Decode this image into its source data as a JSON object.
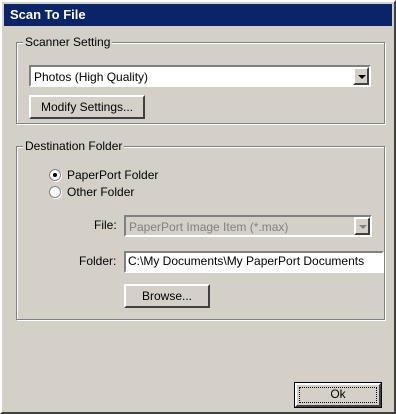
{
  "window": {
    "title": "Scan To File"
  },
  "scanner_setting": {
    "legend": "Scanner Setting",
    "selected": "Photos (High Quality)",
    "modify_button": "Modify Settings..."
  },
  "destination": {
    "legend": "Destination Folder",
    "radios": [
      {
        "label": "PaperPort Folder",
        "checked": true
      },
      {
        "label": "Other Folder",
        "checked": false
      }
    ],
    "file_label": "File:",
    "file_value": "PaperPort Image Item (*.max)",
    "folder_label": "Folder:",
    "folder_value": "C:\\My Documents\\My PaperPort Documents",
    "browse_button": "Browse..."
  },
  "ok_button": "Ok"
}
